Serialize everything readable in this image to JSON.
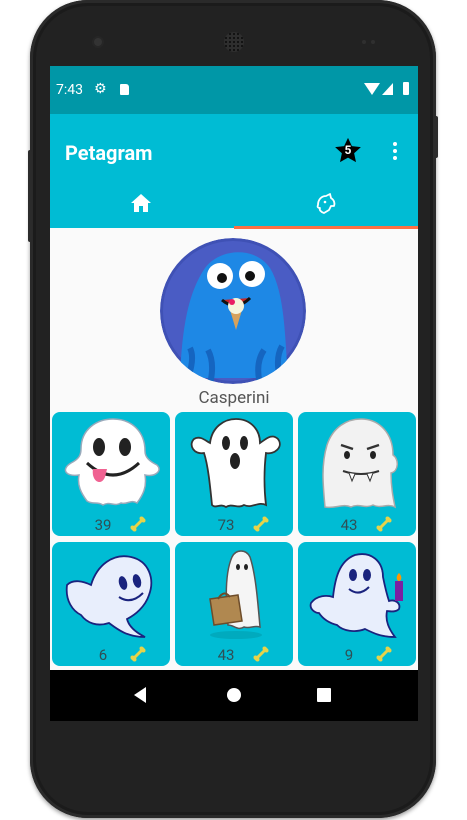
{
  "status_bar": {
    "time": "7:43"
  },
  "app_bar": {
    "title": "Petagram",
    "star_badge": "5"
  },
  "tabs": [
    {
      "icon": "home-icon"
    },
    {
      "icon": "dog-icon"
    }
  ],
  "profile": {
    "name": "Casperini"
  },
  "pets": [
    {
      "likes": "39",
      "icon": "ghost-tongue"
    },
    {
      "likes": "73",
      "icon": "ghost-scream"
    },
    {
      "likes": "43",
      "icon": "ghost-fangs"
    },
    {
      "likes": "6",
      "icon": "ghost-flying"
    },
    {
      "likes": "43",
      "icon": "ghost-sheet-bag"
    },
    {
      "likes": "9",
      "icon": "ghost-candle"
    }
  ],
  "colors": {
    "primary": "#00bcd4",
    "primary_dark": "#0097a7",
    "accent": "#ff7043",
    "bone": "#e6d34a"
  }
}
